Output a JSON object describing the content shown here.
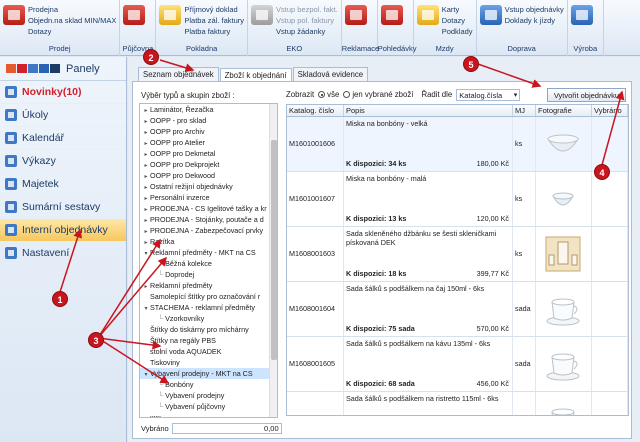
{
  "ribbon": {
    "groups": [
      {
        "title": "Prodej",
        "icon": "red",
        "labels": [
          "Prodejna",
          "Objedn.na sklad MIN/MAX",
          "Dotazy"
        ],
        "disabled": []
      },
      {
        "title": "Půjčovna",
        "icon": "red",
        "labels": [],
        "disabled": []
      },
      {
        "title": "Pokladna",
        "icon": "yellow",
        "labels": [
          "Příjmový doklad",
          "Platba zál. faktury",
          "Platba faktury"
        ],
        "disabled": []
      },
      {
        "title": "EKO",
        "icon": "grey",
        "labels": [
          "Vstup bezpol. fakt.",
          "Vstup pol. faktury",
          "Vstup žádanky"
        ],
        "disabled": [
          0,
          1
        ]
      },
      {
        "title": "Reklamace",
        "icon": "red",
        "labels": [],
        "disabled": []
      },
      {
        "title": "Pohledávky",
        "icon": "red",
        "labels": [],
        "disabled": []
      },
      {
        "title": "Mzdy",
        "icon": "yellow",
        "labels": [
          "Karty",
          "Dotazy",
          "Podklady"
        ],
        "disabled": []
      },
      {
        "title": "Doprava",
        "icon": "blue",
        "labels": [
          "Vstup objednávky",
          "Doklady k jízdy"
        ],
        "disabled": []
      },
      {
        "title": "Výroba",
        "icon": "blue",
        "labels": [],
        "disabled": []
      }
    ]
  },
  "nav": {
    "panely": "Panely",
    "items": [
      {
        "label": "Novinky(10)",
        "icon": "news-icon",
        "style": "hl"
      },
      {
        "label": "Úkoly",
        "icon": "tasks-icon",
        "style": ""
      },
      {
        "label": "Kalendář",
        "icon": "calendar-icon",
        "style": ""
      },
      {
        "label": "Výkazy",
        "icon": "reports-icon",
        "style": ""
      },
      {
        "label": "Majetek",
        "icon": "assets-icon",
        "style": ""
      },
      {
        "label": "Sumární sestavy",
        "icon": "summary-icon",
        "style": ""
      },
      {
        "label": "Interní objednávky",
        "icon": "orders-icon",
        "style": "active"
      },
      {
        "label": "Nastavení",
        "icon": "settings-icon",
        "style": ""
      }
    ]
  },
  "tabs": [
    "Seznam objednávek",
    "Zboží k objednání",
    "Skladová evidence"
  ],
  "active_tab": 1,
  "tree": {
    "title": "Výběr typů a skupin zboží :",
    "rows": [
      {
        "label": "Laminátor, Řezačka",
        "level": 1,
        "exp": "›"
      },
      {
        "label": "OOPP - pro sklad",
        "level": 1,
        "exp": "›"
      },
      {
        "label": "OOPP pro Archiv",
        "level": 1,
        "exp": "›"
      },
      {
        "label": "OOPP pro Atelier",
        "level": 1,
        "exp": "›"
      },
      {
        "label": "OOPP pro Dekmetal",
        "level": 1,
        "exp": "›"
      },
      {
        "label": "OOPP pro Dekprojekt",
        "level": 1,
        "exp": "›"
      },
      {
        "label": "OOPP pro Dekwood",
        "level": 1,
        "exp": "›"
      },
      {
        "label": "Ostatní režijní objednávky",
        "level": 1,
        "exp": "›"
      },
      {
        "label": "Personální inzerce",
        "level": 1,
        "exp": "›"
      },
      {
        "label": "PRODEJNA - CS Igelitové tašky a kr",
        "level": 1,
        "exp": "›"
      },
      {
        "label": "PRODEJNA - Stojánky, poutače a d",
        "level": 1,
        "exp": "›"
      },
      {
        "label": "PRODEJNA - Zabezpečovací prvky",
        "level": 1,
        "exp": "›"
      },
      {
        "label": "Razítka",
        "level": 1,
        "exp": "›"
      },
      {
        "label": "Reklamní předměty - MKT na CS",
        "level": 1,
        "exp": "⌄"
      },
      {
        "label": "Běžná kolekce",
        "level": 2,
        "exp": ""
      },
      {
        "label": "Doprodej",
        "level": 2,
        "exp": ""
      },
      {
        "label": "Reklamní předměty",
        "level": 1,
        "exp": "›"
      },
      {
        "label": "Samolepící štítky pro označování r",
        "level": 1,
        "exp": ""
      },
      {
        "label": "STACHEMA - reklamní předměty",
        "level": 1,
        "exp": "⌄"
      },
      {
        "label": "Vzorkovníky",
        "level": 2,
        "exp": ""
      },
      {
        "label": "Štítky do tiskárny pro míchárny",
        "level": 1,
        "exp": ""
      },
      {
        "label": "Štítky na regály PBS",
        "level": 1,
        "exp": ""
      },
      {
        "label": "stolní voda AQUADEK",
        "level": 1,
        "exp": ""
      },
      {
        "label": "Tiskoviny",
        "level": 1,
        "exp": ""
      },
      {
        "label": "Vybavení prodejny - MKT na CS",
        "level": 1,
        "exp": "⌄",
        "sel": true
      },
      {
        "label": "Bonbóny",
        "level": 2,
        "exp": ""
      },
      {
        "label": "Vybavení prodejny",
        "level": 2,
        "exp": ""
      },
      {
        "label": "Vybavení půjčovny",
        "level": 2,
        "exp": ""
      },
      {
        "label": "xxx",
        "level": 1,
        "exp": "›"
      }
    ]
  },
  "vybrano": {
    "label": "Vybráno",
    "value": "0,00"
  },
  "toolbar": {
    "zobrazit": "Zobrazit",
    "opt_all": "vše",
    "opt_selected": "jen vybrané zboží",
    "sort_label": "Řadit dle",
    "sort_value": "Katalog.čísla",
    "create_button": "Vytvořit objednávku"
  },
  "grid": {
    "headers": [
      "Katalog. číslo",
      "Popis",
      "MJ",
      "Fotografie",
      "Vybráno"
    ],
    "rows": [
      {
        "code": "M1601001606",
        "name": "Miska na bonbóny - velká",
        "avail": "K dispozici: 34 ks",
        "price": "180,00 Kč",
        "mj": "ks",
        "photo": "bowl-large"
      },
      {
        "code": "M1601001607",
        "name": "Miska na bonbóny - malá",
        "avail": "K dispozici: 13 ks",
        "price": "120,00 Kč",
        "mj": "ks",
        "photo": "bowl-small"
      },
      {
        "code": "M1608001603",
        "name": "Sada skleněného džbánku se šesti skleničkami pískovaná DEK",
        "avail": "K dispozici: 18 ks",
        "price": "399,77 Kč",
        "mj": "ks",
        "photo": "jug-set"
      },
      {
        "code": "M1608001604",
        "name": "Sada šálků s podšálkem na čaj 150ml - 6ks",
        "avail": "K dispozici: 75 sada",
        "price": "570,00 Kč",
        "mj": "sada",
        "photo": "cup"
      },
      {
        "code": "M1608001605",
        "name": "Sada šálků s podšálkem na kávu 135ml - 6ks",
        "avail": "K dispozici: 68 sada",
        "price": "456,00 Kč",
        "mj": "sada",
        "photo": "cup"
      },
      {
        "code": "",
        "name": "Sada šálků s podšálkem na ristretto 115ml - 6ks",
        "avail": "",
        "price": "",
        "mj": "",
        "photo": "cup"
      }
    ]
  },
  "annotations": [
    "1",
    "2",
    "3",
    "4",
    "5"
  ],
  "colors": {
    "accent": "#c9151d",
    "active_nav": "#f7c85c",
    "selected_row": "#cde4ff"
  }
}
